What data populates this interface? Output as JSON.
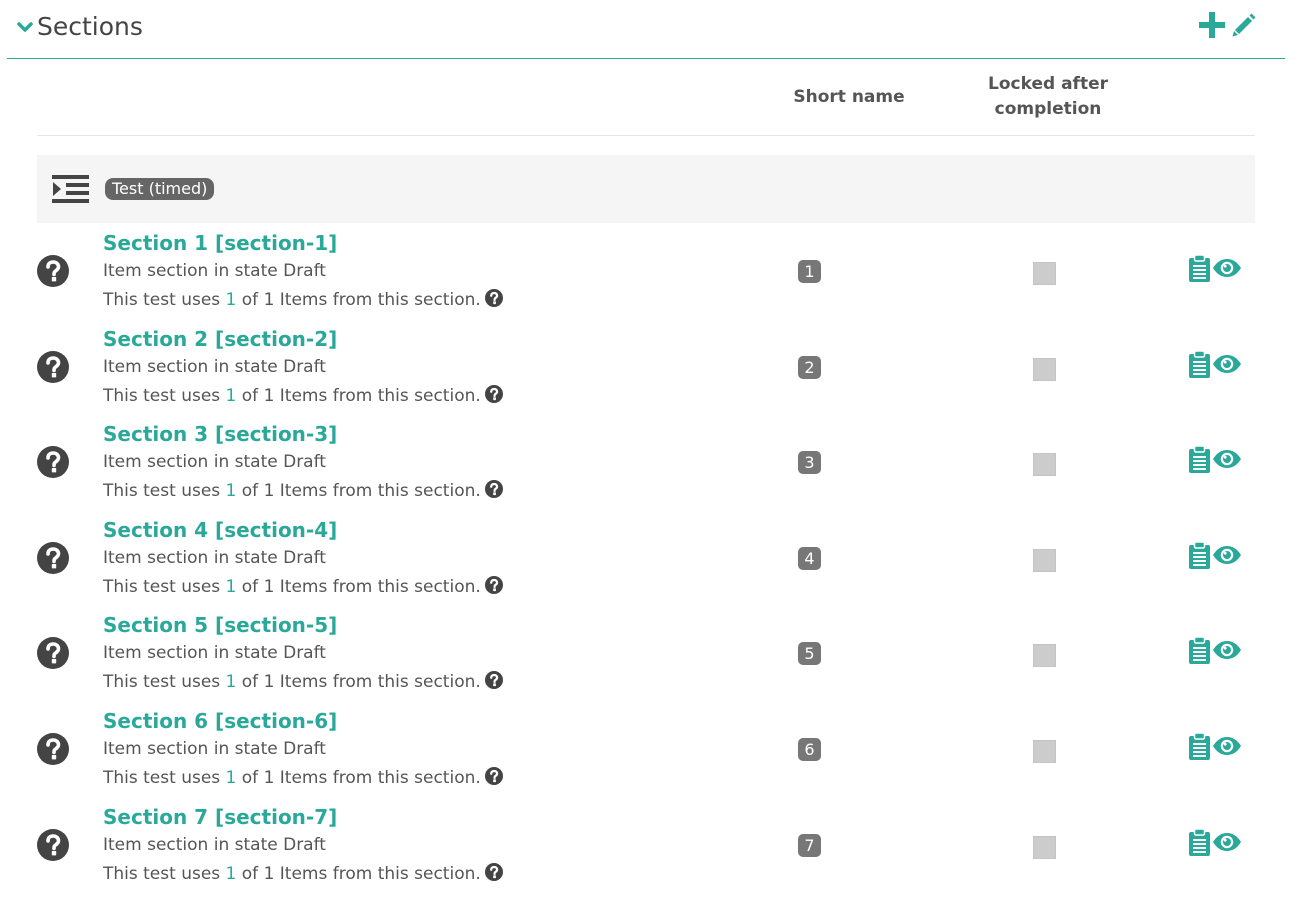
{
  "header": {
    "title": "Sections"
  },
  "columns": {
    "short_name": "Short name",
    "locked": "Locked after\ncompletion"
  },
  "group": {
    "label": "Test (timed)"
  },
  "colors": {
    "accent": "#2aa89a",
    "badge": "#777777",
    "text": "#444444"
  },
  "icons": {
    "collapse": "chevron-down-icon",
    "add": "plus-icon",
    "edit": "pencil-icon",
    "group": "indent-list-icon",
    "row_status": "question-circle-icon",
    "help": "question-circle-icon",
    "clipboard": "clipboard-icon",
    "preview": "eye-icon"
  },
  "sections": [
    {
      "title": "Section 1 [section-1]",
      "state": "Item section in state Draft",
      "uses_prefix": "This test uses ",
      "uses_count": "1",
      "uses_suffix": " of 1 Items from this section.",
      "short": "1",
      "locked": false
    },
    {
      "title": "Section 2 [section-2]",
      "state": "Item section in state Draft",
      "uses_prefix": "This test uses ",
      "uses_count": "1",
      "uses_suffix": " of 1 Items from this section.",
      "short": "2",
      "locked": false
    },
    {
      "title": "Section 3 [section-3]",
      "state": "Item section in state Draft",
      "uses_prefix": "This test uses ",
      "uses_count": "1",
      "uses_suffix": " of 1 Items from this section.",
      "short": "3",
      "locked": false
    },
    {
      "title": "Section 4 [section-4]",
      "state": "Item section in state Draft",
      "uses_prefix": "This test uses ",
      "uses_count": "1",
      "uses_suffix": " of 1 Items from this section.",
      "short": "4",
      "locked": false
    },
    {
      "title": "Section 5 [section-5]",
      "state": "Item section in state Draft",
      "uses_prefix": "This test uses ",
      "uses_count": "1",
      "uses_suffix": " of 1 Items from this section.",
      "short": "5",
      "locked": false
    },
    {
      "title": "Section 6 [section-6]",
      "state": "Item section in state Draft",
      "uses_prefix": "This test uses ",
      "uses_count": "1",
      "uses_suffix": " of 1 Items from this section.",
      "short": "6",
      "locked": false
    },
    {
      "title": "Section 7 [section-7]",
      "state": "Item section in state Draft",
      "uses_prefix": "This test uses ",
      "uses_count": "1",
      "uses_suffix": " of 1 Items from this section.",
      "short": "7",
      "locked": false
    }
  ]
}
